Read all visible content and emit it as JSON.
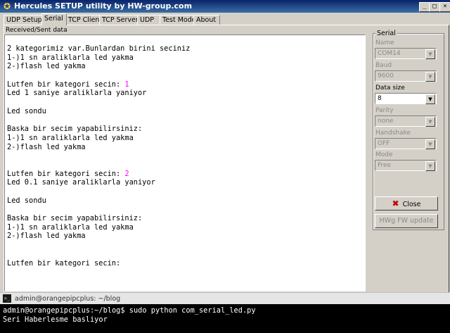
{
  "window": {
    "title": "Hercules SETUP utility by HW-group.com",
    "minimize_glyph": "_",
    "maximize_glyph": "□",
    "close_glyph": "×"
  },
  "tabs": [
    {
      "label": "UDP Setup"
    },
    {
      "label": "Serial"
    },
    {
      "label": "TCP Client"
    },
    {
      "label": "TCP Server"
    },
    {
      "label": "UDP"
    },
    {
      "label": "Test Mode"
    },
    {
      "label": "About"
    }
  ],
  "received": {
    "label": "Received/Sent data",
    "lines": [
      {
        "text": "2 kategorimiz var.Bunlardan birini seciniz",
        "echo": ""
      },
      {
        "text": "1-)1 sn araliklarla led yakma",
        "echo": ""
      },
      {
        "text": "2-)flash led yakma",
        "echo": ""
      },
      {
        "text": "",
        "echo": ""
      },
      {
        "text": "Lutfen bir kategori secin: ",
        "echo": "1"
      },
      {
        "text": "Led 1 saniye araliklarla yaniyor",
        "echo": ""
      },
      {
        "text": "",
        "echo": ""
      },
      {
        "text": "Led sondu",
        "echo": ""
      },
      {
        "text": "",
        "echo": ""
      },
      {
        "text": "Baska bir secim yapabilirsiniz:",
        "echo": ""
      },
      {
        "text": "1-)1 sn araliklarla led yakma",
        "echo": ""
      },
      {
        "text": "2-)flash led yakma",
        "echo": ""
      },
      {
        "text": "",
        "echo": ""
      },
      {
        "text": "",
        "echo": ""
      },
      {
        "text": "Lutfen bir kategori secin: ",
        "echo": "2"
      },
      {
        "text": "Led 0.1 saniye araliklarla yaniyor",
        "echo": ""
      },
      {
        "text": "",
        "echo": ""
      },
      {
        "text": "Led sondu",
        "echo": ""
      },
      {
        "text": "",
        "echo": ""
      },
      {
        "text": "Baska bir secim yapabilirsiniz:",
        "echo": ""
      },
      {
        "text": "1-)1 sn araliklarla led yakma",
        "echo": ""
      },
      {
        "text": "2-)flash led yakma",
        "echo": ""
      },
      {
        "text": "",
        "echo": ""
      },
      {
        "text": "",
        "echo": ""
      },
      {
        "text": "Lutfen bir kategori secin:",
        "echo": ""
      }
    ]
  },
  "serial": {
    "group_label": "Serial",
    "fields": [
      {
        "label": "Name",
        "value": "COM14",
        "enabled": false
      },
      {
        "label": "Baud",
        "value": "9600",
        "enabled": false
      },
      {
        "label": "Data size",
        "value": "8",
        "enabled": true
      },
      {
        "label": "Parity",
        "value": "none",
        "enabled": false
      },
      {
        "label": "Handshake",
        "value": "OFF",
        "enabled": false
      },
      {
        "label": "Mode",
        "value": "Free",
        "enabled": false
      }
    ],
    "close_button": "Close",
    "fw_update_button": "HWg FW update"
  },
  "terminal": {
    "title": "admin@orangepipcplus: ~/blog",
    "lines": [
      "admin@orangepipcplus:~/blog$ sudo python com_serial_led.py",
      "Seri Haberlesme basliyor"
    ]
  }
}
